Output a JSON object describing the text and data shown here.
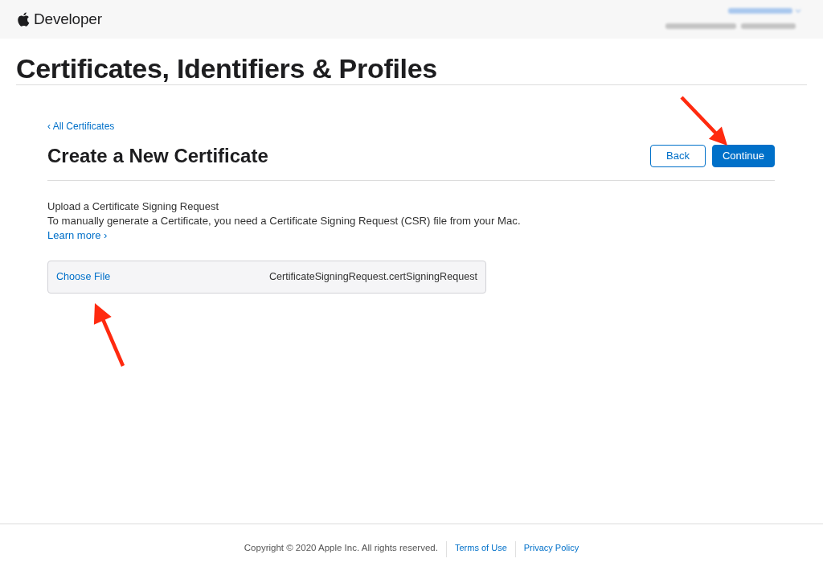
{
  "header": {
    "brand": "Developer"
  },
  "page_title": "Certificates, Identifiers & Profiles",
  "breadcrumb": "‹ All Certificates",
  "heading": "Create a New Certificate",
  "buttons": [
    {
      "label": "Back",
      "kind": "secondary"
    },
    {
      "label": "Continue",
      "kind": "primary"
    }
  ],
  "section": {
    "title": "Upload a Certificate Signing Request",
    "description": "To manually generate a Certificate, you need a Certificate Signing Request (CSR) file from your Mac.",
    "link": "Learn more ›"
  },
  "file_input": {
    "button": "Choose File",
    "value": "CertificateSigningRequest.certSigningRequest"
  },
  "footer": {
    "copyright": "Copyright © 2020 Apple Inc. All rights reserved.",
    "links": [
      "Terms of Use",
      "Privacy Policy"
    ]
  }
}
